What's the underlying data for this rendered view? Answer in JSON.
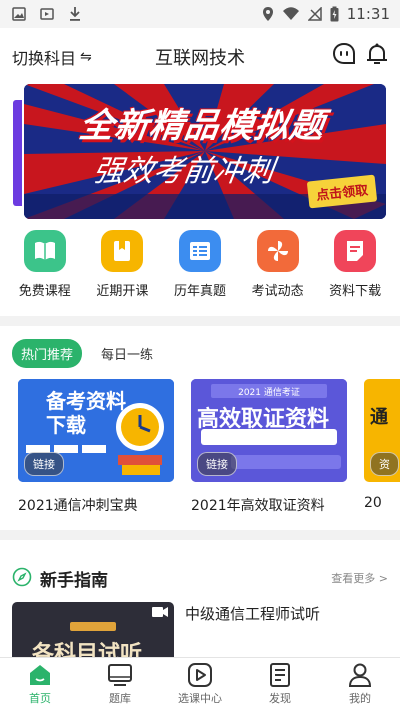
{
  "status_bar": {
    "time": "11:31"
  },
  "header": {
    "switch_label": "切换科目",
    "title": "互联网技术"
  },
  "banner": {
    "title": "全新精品模拟题",
    "subtitle": "强效考前冲刺",
    "cta": "点击领取"
  },
  "quick_menu": [
    {
      "label": "免费课程",
      "icon": "book-icon",
      "color": "#3cc48a"
    },
    {
      "label": "近期开课",
      "icon": "bookmark-icon",
      "color": "#f7b500"
    },
    {
      "label": "历年真题",
      "icon": "list-icon",
      "color": "#3c8df0"
    },
    {
      "label": "考试动态",
      "icon": "pinwheel-icon",
      "color": "#f26a3a"
    },
    {
      "label": "资料下载",
      "icon": "document-icon",
      "color": "#f0455a"
    }
  ],
  "recommend": {
    "tabs": [
      "热门推荐",
      "每日一练"
    ],
    "cards": [
      {
        "image_title": "备考资料下载",
        "link": "链接",
        "caption": "2021通信冲刺宝典"
      },
      {
        "image_title": "高效取证资料",
        "image_top": "2021 通信考证",
        "link": "链接",
        "caption": "2021年高效取证资料"
      },
      {
        "image_title": "通",
        "link": "资",
        "caption": "20"
      }
    ]
  },
  "guide": {
    "title": "新手指南",
    "more": "查看更多 >",
    "item_title": "中级通信工程师试听",
    "thumb_text": "各科目试听"
  },
  "bottom_nav": [
    {
      "label": "首页",
      "icon": "home-icon",
      "active": true
    },
    {
      "label": "题库",
      "icon": "monitor-icon"
    },
    {
      "label": "选课中心",
      "icon": "play-icon"
    },
    {
      "label": "发现",
      "icon": "notebook-icon"
    },
    {
      "label": "我的",
      "icon": "user-icon"
    }
  ],
  "colors": {
    "accent": "#2bb36b"
  }
}
